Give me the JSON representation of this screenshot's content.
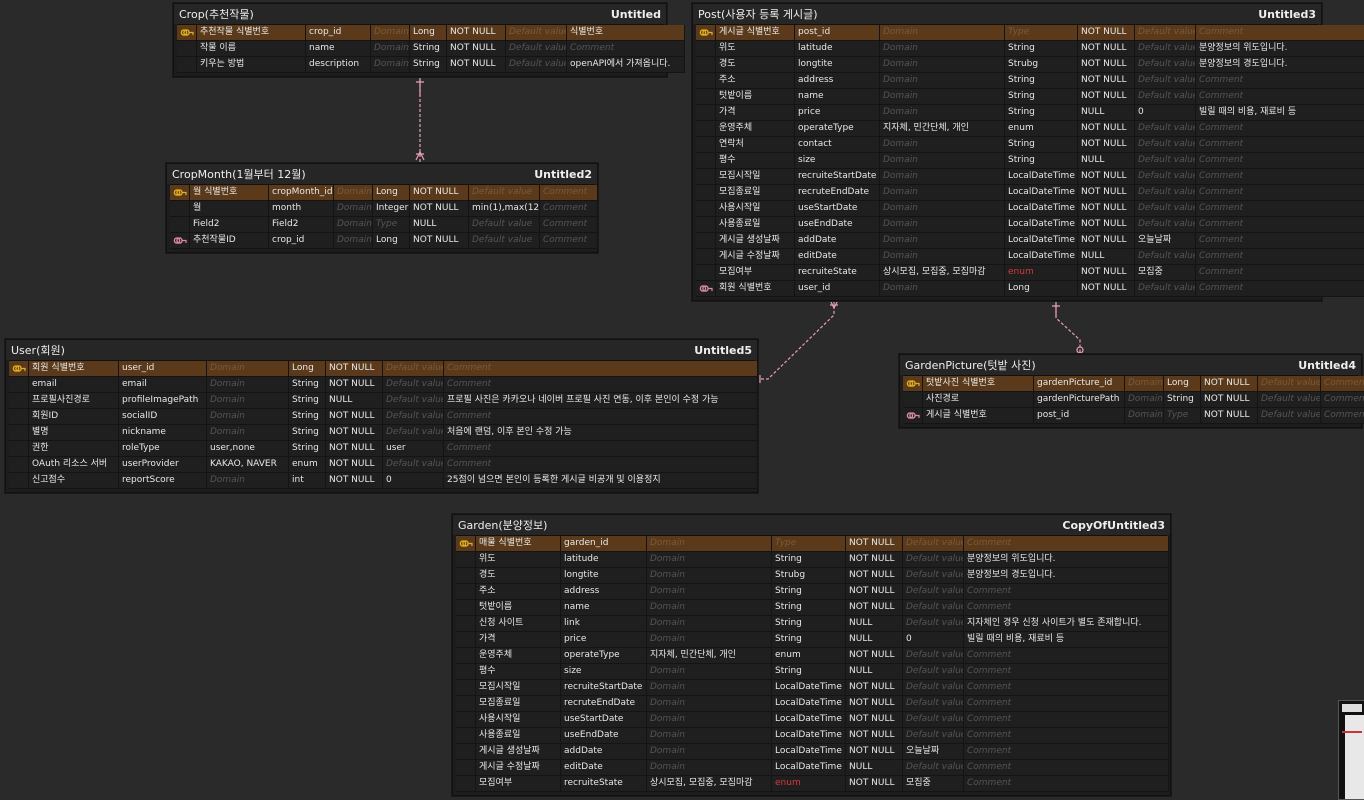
{
  "colors": {
    "background": "#2a2a2a",
    "selected_row": "#5a3a1a",
    "pk_key": "#e0b020",
    "fk_key": "#d88aa0",
    "relation": "#e8a0b8",
    "enum": "#d23a3a"
  },
  "placeholders": {
    "domain": "Domain",
    "type": "Type",
    "default": "Default value",
    "comment": "Comment"
  },
  "entities": [
    {
      "id": "crop",
      "title": "Crop(추천작물)",
      "alias": "Untitled",
      "rows": [
        {
          "key": "pk",
          "c": [
            "추천작물 식별번호",
            "crop_id",
            "",
            "Long",
            "NOT NULL",
            "",
            "식별번호"
          ]
        },
        {
          "key": "",
          "c": [
            "작물 이름",
            "name",
            "",
            "String",
            "NOT NULL",
            "",
            ""
          ]
        },
        {
          "key": "",
          "c": [
            "키우는 방법",
            "description",
            "",
            "String",
            "NOT NULL",
            "",
            "openAPI에서 가져옵니다."
          ]
        }
      ]
    },
    {
      "id": "cropmonth",
      "title": "CropMonth(1월부터 12월)",
      "alias": "Untitled2",
      "rows": [
        {
          "key": "pk",
          "c": [
            "월 식별번호",
            "cropMonth_id",
            "",
            "Long",
            "NOT NULL",
            "",
            ""
          ]
        },
        {
          "key": "",
          "c": [
            "월",
            "month",
            "",
            "Integer",
            "NOT NULL",
            "min(1),max(12)",
            ""
          ]
        },
        {
          "key": "",
          "c": [
            "Field2",
            "Field2",
            "",
            "",
            "NULL",
            "",
            ""
          ]
        },
        {
          "key": "fk",
          "c": [
            "추천작물ID",
            "crop_id",
            "",
            "Long",
            "NOT NULL",
            "",
            ""
          ]
        }
      ]
    },
    {
      "id": "post",
      "title": "Post(사용자 등록 게시글)",
      "alias": "Untitled3",
      "rows": [
        {
          "key": "pk",
          "c": [
            "게시글 식별번호",
            "post_id",
            "",
            "",
            "NOT NULL",
            "",
            ""
          ]
        },
        {
          "key": "",
          "c": [
            "위도",
            "latitude",
            "",
            "String",
            "NOT NULL",
            "",
            "분양정보의 위도입니다."
          ]
        },
        {
          "key": "",
          "c": [
            "경도",
            "longtite",
            "",
            "Strubg",
            "NOT NULL",
            "",
            "분양정보의 경도입니다."
          ]
        },
        {
          "key": "",
          "c": [
            "주소",
            "address",
            "",
            "String",
            "NOT NULL",
            "",
            ""
          ]
        },
        {
          "key": "",
          "c": [
            "텃밭이름",
            "name",
            "",
            "String",
            "NOT NULL",
            "",
            ""
          ]
        },
        {
          "key": "",
          "c": [
            "가격",
            "price",
            "",
            "String",
            "NULL",
            "0",
            "빌릴 때의 비용, 재료비 등"
          ]
        },
        {
          "key": "",
          "c": [
            "운영주체",
            "operateType",
            "지자체, 민간단체, 개인",
            "enum",
            "NOT NULL",
            "",
            ""
          ]
        },
        {
          "key": "",
          "c": [
            "연락처",
            "contact",
            "",
            "String",
            "NOT NULL",
            "",
            ""
          ]
        },
        {
          "key": "",
          "c": [
            "평수",
            "size",
            "",
            "String",
            "NULL",
            "",
            ""
          ]
        },
        {
          "key": "",
          "c": [
            "모집시작일",
            "recruiteStartDate",
            "",
            "LocalDateTime",
            "NOT NULL",
            "",
            ""
          ]
        },
        {
          "key": "",
          "c": [
            "모집종료일",
            "recruteEndDate",
            "",
            "LocalDateTime",
            "NOT NULL",
            "",
            ""
          ]
        },
        {
          "key": "",
          "c": [
            "사용시작일",
            "useStartDate",
            "",
            "LocalDateTime",
            "NOT NULL",
            "",
            ""
          ]
        },
        {
          "key": "",
          "c": [
            "사용종료일",
            "useEndDate",
            "",
            "LocalDateTime",
            "NOT NULL",
            "",
            ""
          ]
        },
        {
          "key": "",
          "c": [
            "게시글 생성날짜",
            "addDate",
            "",
            "LocalDateTime",
            "NOT NULL",
            "오늘날짜",
            ""
          ]
        },
        {
          "key": "",
          "c": [
            "게시글 수정날짜",
            "editDate",
            "",
            "LocalDateTime",
            "NULL",
            "",
            ""
          ]
        },
        {
          "key": "",
          "c": [
            "모집여부",
            "recruiteState",
            "상시모집, 모집중, 모집마감",
            "enum",
            "NOT NULL",
            "모집중",
            ""
          ]
        },
        {
          "key": "fk",
          "c": [
            "회원 식별번호",
            "user_id",
            "",
            "Long",
            "NOT NULL",
            "",
            ""
          ]
        }
      ]
    },
    {
      "id": "user",
      "title": "User(회원)",
      "alias": "Untitled5",
      "rows": [
        {
          "key": "pk",
          "c": [
            "회원 식별번호",
            "user_id",
            "",
            "Long",
            "NOT NULL",
            "",
            ""
          ]
        },
        {
          "key": "",
          "c": [
            "email",
            "email",
            "",
            "String",
            "NOT NULL",
            "",
            ""
          ]
        },
        {
          "key": "",
          "c": [
            "프로필사진경로",
            "profileImagePath",
            "",
            "String",
            "NULL",
            "",
            "프로필 사진은 카카오나 네이버 프로필 사진 연동, 이후 본인이 수정 가능"
          ]
        },
        {
          "key": "",
          "c": [
            "회원ID",
            "socialID",
            "",
            "String",
            "NOT NULL",
            "",
            ""
          ]
        },
        {
          "key": "",
          "c": [
            "별명",
            "nickname",
            "",
            "String",
            "NOT NULL",
            "",
            "처음에 랜덤, 이후 본인 수정 가능"
          ]
        },
        {
          "key": "",
          "c": [
            "권한",
            "roleType",
            "user,none",
            "String",
            "NOT NULL",
            "user",
            ""
          ]
        },
        {
          "key": "",
          "c": [
            "OAuth 리소스 서버",
            "userProvider",
            "KAKAO, NAVER",
            "enum",
            "NOT NULL",
            "",
            ""
          ]
        },
        {
          "key": "",
          "c": [
            "신고점수",
            "reportScore",
            "",
            "int",
            "NOT NULL",
            "0",
            "25점이 넘으면 본인이 등록한 게시글 비공개 및 이용정지"
          ]
        }
      ]
    },
    {
      "id": "gardenpicture",
      "title": "GardenPicture(텃밭 사진)",
      "alias": "Untitled4",
      "rows": [
        {
          "key": "pk",
          "c": [
            "텃밭사진 식별번호",
            "gardenPicture_id",
            "",
            "Long",
            "NOT NULL",
            "",
            ""
          ]
        },
        {
          "key": "",
          "c": [
            "사진경로",
            "gardenPicturePath",
            "",
            "String",
            "NOT NULL",
            "",
            ""
          ]
        },
        {
          "key": "fk",
          "c": [
            "게시글 식별번호",
            "post_id",
            "",
            "",
            "NOT NULL",
            "",
            ""
          ]
        }
      ]
    },
    {
      "id": "garden",
      "title": "Garden(분양정보)",
      "alias": "CopyOfUntitled3",
      "rows": [
        {
          "key": "pk",
          "c": [
            "매물 식별번호",
            "garden_id",
            "",
            "",
            "NOT NULL",
            "",
            ""
          ]
        },
        {
          "key": "",
          "c": [
            "위도",
            "latitude",
            "",
            "String",
            "NOT NULL",
            "",
            "분양정보의 위도입니다."
          ]
        },
        {
          "key": "",
          "c": [
            "경도",
            "longtite",
            "",
            "Strubg",
            "NOT NULL",
            "",
            "분양정보의 경도입니다."
          ]
        },
        {
          "key": "",
          "c": [
            "주소",
            "address",
            "",
            "String",
            "NOT NULL",
            "",
            ""
          ]
        },
        {
          "key": "",
          "c": [
            "텃밭이름",
            "name",
            "",
            "String",
            "NOT NULL",
            "",
            ""
          ]
        },
        {
          "key": "",
          "c": [
            "신청 사이트",
            "link",
            "",
            "String",
            "NULL",
            "",
            "지자체인 경우 신청 사이트가 별도 존재합니다."
          ]
        },
        {
          "key": "",
          "c": [
            "가격",
            "price",
            "",
            "String",
            "NULL",
            "0",
            "빌릴 때의 비용, 재료비 등"
          ]
        },
        {
          "key": "",
          "c": [
            "운영주체",
            "operateType",
            "지자체, 민간단체, 개인",
            "enum",
            "NOT NULL",
            "",
            ""
          ]
        },
        {
          "key": "",
          "c": [
            "평수",
            "size",
            "",
            "String",
            "NULL",
            "",
            ""
          ]
        },
        {
          "key": "",
          "c": [
            "모집시작일",
            "recruiteStartDate",
            "",
            "LocalDateTime",
            "NOT NULL",
            "",
            ""
          ]
        },
        {
          "key": "",
          "c": [
            "모집종료일",
            "recruteEndDate",
            "",
            "LocalDateTime",
            "NOT NULL",
            "",
            ""
          ]
        },
        {
          "key": "",
          "c": [
            "사용시작일",
            "useStartDate",
            "",
            "LocalDateTime",
            "NOT NULL",
            "",
            ""
          ]
        },
        {
          "key": "",
          "c": [
            "사용종료일",
            "useEndDate",
            "",
            "LocalDateTime",
            "NOT NULL",
            "",
            ""
          ]
        },
        {
          "key": "",
          "c": [
            "게시글 생성날짜",
            "addDate",
            "",
            "LocalDateTime",
            "NOT NULL",
            "오늘날짜",
            ""
          ]
        },
        {
          "key": "",
          "c": [
            "게시글 수정날짜",
            "editDate",
            "",
            "LocalDateTime",
            "NULL",
            "",
            ""
          ]
        },
        {
          "key": "",
          "c": [
            "모집여부",
            "recruiteState",
            "상시모집, 모집중, 모집마감",
            "enum",
            "NOT NULL",
            "모집중",
            ""
          ]
        }
      ]
    }
  ]
}
